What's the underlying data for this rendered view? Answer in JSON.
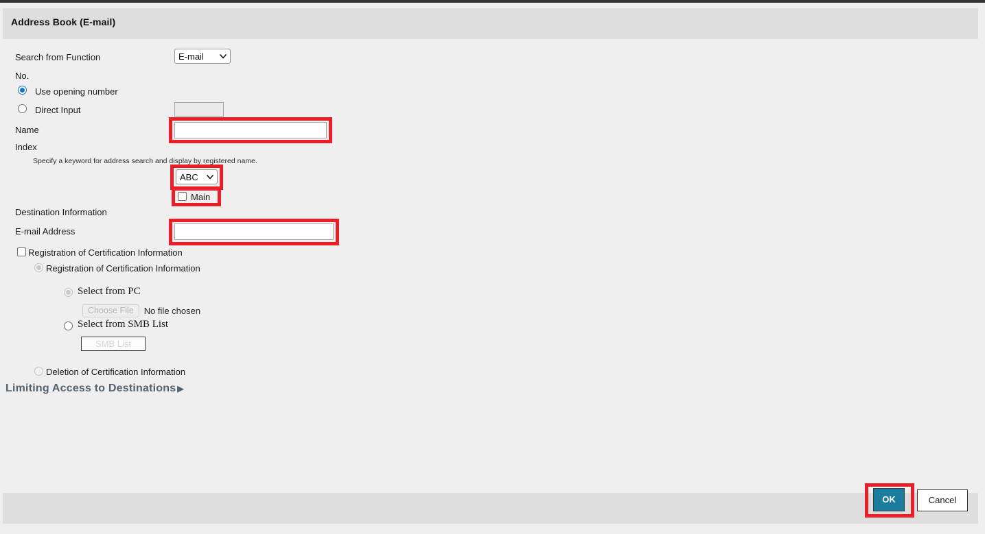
{
  "window": {
    "title": "Address Book (E-mail)"
  },
  "form": {
    "search_from_function": {
      "label": "Search from Function",
      "value": "E-mail",
      "options": [
        "E-mail"
      ]
    },
    "no": {
      "label": "No.",
      "use_opening_number_label": "Use opening number",
      "direct_input_label": "Direct Input",
      "direct_input_value": ""
    },
    "name": {
      "label": "Name",
      "value": "",
      "placeholder": ""
    },
    "index": {
      "label": "Index",
      "helper": "Specify a keyword for address search and display by registered name.",
      "value": "ABC",
      "options": [
        "ABC"
      ],
      "main_label": "Main"
    },
    "destination_information": {
      "label": "Destination Information",
      "email_address": {
        "label": "E-mail Address",
        "value": "",
        "placeholder": ""
      }
    },
    "certification": {
      "enable_label": "Registration of Certification Information",
      "registration_label": "Registration of Certification Information",
      "select_from_pc_label": "Select from PC",
      "choose_file_label": "Choose File",
      "no_file_chosen_label": "No file chosen",
      "select_from_smb_label": "Select from SMB List",
      "smb_list_button_label": "SMB List",
      "deletion_label": "Deletion of Certification Information"
    },
    "limiting_access": {
      "label": "Limiting Access to Destinations",
      "caret": "▶"
    }
  },
  "footer": {
    "ok_label": "OK",
    "cancel_label": "Cancel"
  },
  "colors": {
    "highlight": "#e81f26",
    "ok_button": "#1a7d9e",
    "titlebar": "#dedede",
    "page_background": "#efefef",
    "expander_text": "#55616d",
    "radio_selected": "#1076d1"
  }
}
